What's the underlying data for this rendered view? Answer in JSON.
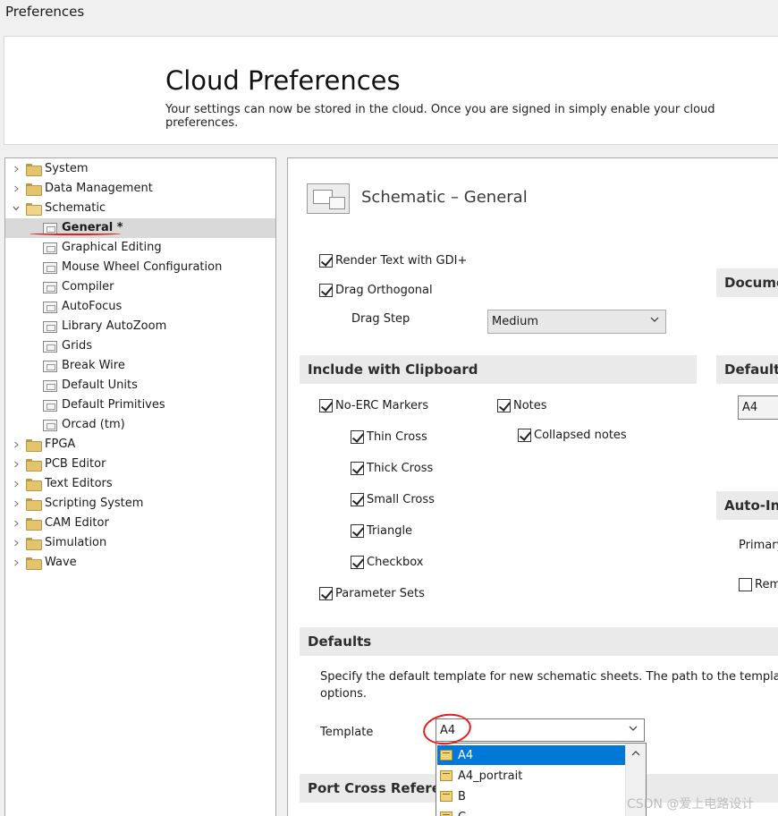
{
  "window": {
    "title": "Preferences"
  },
  "banner": {
    "title": "Cloud Preferences",
    "subtitle": "Your settings can now be stored in the cloud. Once you are signed in simply enable your cloud preferences."
  },
  "tree": {
    "items": [
      {
        "label": "System",
        "type": "folder",
        "expanded": false
      },
      {
        "label": "Data Management",
        "type": "folder",
        "expanded": false
      },
      {
        "label": "Schematic",
        "type": "folder",
        "expanded": true
      },
      {
        "label": "General *",
        "type": "page",
        "selected": true
      },
      {
        "label": "Graphical Editing",
        "type": "page"
      },
      {
        "label": "Mouse Wheel Configuration",
        "type": "page"
      },
      {
        "label": "Compiler",
        "type": "page"
      },
      {
        "label": "AutoFocus",
        "type": "page"
      },
      {
        "label": "Library AutoZoom",
        "type": "page"
      },
      {
        "label": "Grids",
        "type": "page"
      },
      {
        "label": "Break Wire",
        "type": "page"
      },
      {
        "label": "Default Units",
        "type": "page"
      },
      {
        "label": "Default Primitives",
        "type": "page"
      },
      {
        "label": "Orcad (tm)",
        "type": "page"
      },
      {
        "label": "FPGA",
        "type": "folder",
        "expanded": false
      },
      {
        "label": "PCB Editor",
        "type": "folder",
        "expanded": false
      },
      {
        "label": "Text Editors",
        "type": "folder",
        "expanded": false
      },
      {
        "label": "Scripting System",
        "type": "folder",
        "expanded": false
      },
      {
        "label": "CAM Editor",
        "type": "folder",
        "expanded": false
      },
      {
        "label": "Simulation",
        "type": "folder",
        "expanded": false
      },
      {
        "label": "Wave",
        "type": "folder",
        "expanded": false
      }
    ]
  },
  "page": {
    "heading": "Schematic – General",
    "render_text_gdi": {
      "label": "Render Text with GDI+",
      "checked": true
    },
    "drag_orthogonal": {
      "label": "Drag Orthogonal",
      "checked": true
    },
    "drag_step": {
      "label": "Drag Step",
      "value": "Medium"
    },
    "clipboard": {
      "title": "Include with Clipboard",
      "no_erc": {
        "label": "No-ERC Markers",
        "checked": true
      },
      "thin_cross": {
        "label": "Thin Cross",
        "checked": true
      },
      "thick_cross": {
        "label": "Thick Cross",
        "checked": true
      },
      "small_cross": {
        "label": "Small Cross",
        "checked": true
      },
      "triangle": {
        "label": "Triangle",
        "checked": true
      },
      "checkbox": {
        "label": "Checkbox",
        "checked": true
      },
      "parameter_sets": {
        "label": "Parameter Sets",
        "checked": true
      },
      "notes": {
        "label": "Notes",
        "checked": true
      },
      "collapsed_notes": {
        "label": "Collapsed notes",
        "checked": true
      }
    },
    "right_sections": {
      "document_title": "Docume",
      "default_title": "Default",
      "default_value": "A4",
      "auto_title": "Auto-In",
      "primary_label": "Primary",
      "rem_label": "Rem",
      "rem_checked": false
    },
    "defaults": {
      "title": "Defaults",
      "description_line1": "Specify the default template for new schematic sheets.  The path to the templates di",
      "description_line2": "options.",
      "template_label": "Template",
      "template_value": "A4",
      "dropdown_options": [
        "A4",
        "A4_portrait",
        "B",
        "C"
      ],
      "highlighted_option": "A4"
    },
    "port_cross": {
      "title": "Port Cross Referen"
    }
  },
  "watermark": "CSDN @爱上电路设计",
  "colors": {
    "highlight": "#0078d7",
    "annotation": "#e0201b",
    "selection": "#d9d9d9"
  }
}
